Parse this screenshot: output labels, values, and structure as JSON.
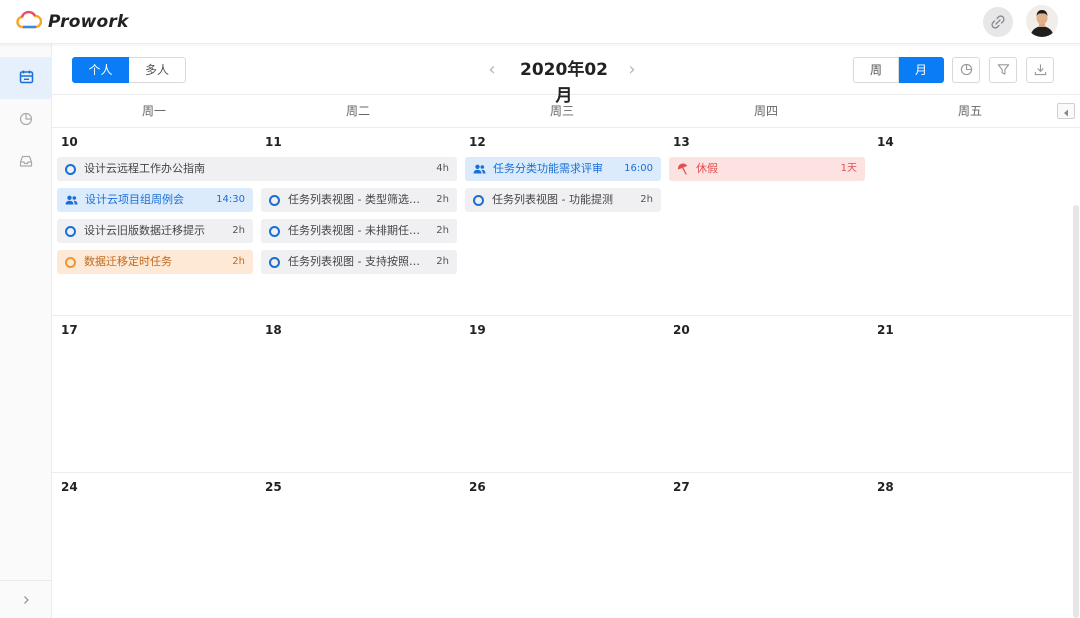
{
  "app": {
    "name": "Prowork"
  },
  "toolbar": {
    "mode_personal": "个人",
    "mode_multi": "多人",
    "month_title": "2020年02月",
    "view_week": "周",
    "view_month": "月"
  },
  "weekdays": [
    "周一",
    "周二",
    "周三",
    "周四",
    "周五"
  ],
  "weeks": [
    {
      "days": [
        "10",
        "11",
        "12",
        "13",
        "14"
      ]
    },
    {
      "days": [
        "17",
        "18",
        "19",
        "20",
        "21"
      ]
    },
    {
      "days": [
        "24",
        "25",
        "26",
        "27",
        "28"
      ]
    }
  ],
  "events": [
    {
      "label": "设计云远程工作办公指南",
      "dur": "4h",
      "style": "gray",
      "icon": "circle-icon"
    },
    {
      "label": "设计云项目组周例会",
      "dur": "14:30",
      "style": "blue",
      "icon": "people-icon"
    },
    {
      "label": "设计云旧版数据迁移提示",
      "dur": "2h",
      "style": "gray",
      "icon": "circle-icon"
    },
    {
      "label": "数据迁移定时任务",
      "dur": "2h",
      "style": "orange",
      "icon": "circle-icon"
    },
    {
      "label": "任务列表视图 - 类型筛选功能",
      "dur": "2h",
      "style": "gray",
      "icon": "circle-icon"
    },
    {
      "label": "任务列表视图 - 未排期任务...",
      "dur": "2h",
      "style": "gray",
      "icon": "circle-icon"
    },
    {
      "label": "任务列表视图 - 支持按照优...",
      "dur": "2h",
      "style": "gray",
      "icon": "circle-icon"
    },
    {
      "label": "任务分类功能需求评审",
      "dur": "16:00",
      "style": "blue",
      "icon": "people-icon"
    },
    {
      "label": "任务列表视图 - 功能提测",
      "dur": "2h",
      "style": "gray",
      "icon": "circle-icon"
    },
    {
      "label": "休假",
      "dur": "1天",
      "style": "red",
      "icon": "beach-umbrella-icon"
    }
  ],
  "colors": {
    "accent": "#0a7cf5",
    "blue_event": "#dcebfc",
    "orange_event": "#fde9d6",
    "red_event": "#fde2e2"
  }
}
